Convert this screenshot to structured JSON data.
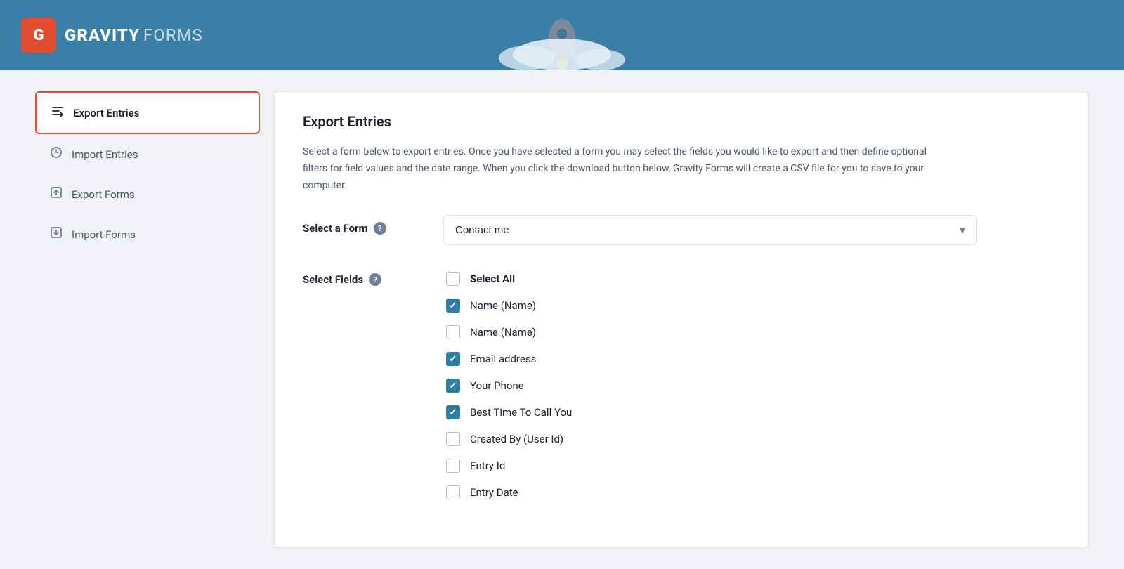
{
  "header": {
    "logo_text_gravity": "GRAVITY",
    "logo_text_forms": "FORMS",
    "logo_letter": "G"
  },
  "sidebar": {
    "items": [
      {
        "id": "export-entries",
        "label": "Export Entries",
        "icon": "export-entries-icon",
        "active": true
      },
      {
        "id": "import-entries",
        "label": "Import Entries",
        "icon": "import-entries-icon",
        "active": false
      },
      {
        "id": "export-forms",
        "label": "Export Forms",
        "icon": "export-forms-icon",
        "active": false
      },
      {
        "id": "import-forms",
        "label": "Import Forms",
        "icon": "import-forms-icon",
        "active": false
      }
    ]
  },
  "content": {
    "title": "Export Entries",
    "description": "Select a form below to export entries. Once you have selected a form you may select the fields you would like to export and then define optional filters for field values and the date range. When you click the download button below, Gravity Forms will create a CSV file for you to save to your computer.",
    "select_form_label": "Select a Form",
    "select_form_placeholder": "Contact me",
    "select_fields_label": "Select Fields",
    "help_tooltip": "?",
    "fields": [
      {
        "id": "select-all",
        "label": "Select All",
        "checked": false,
        "bold": true
      },
      {
        "id": "name-1",
        "label": "Name (Name)",
        "checked": true,
        "bold": false
      },
      {
        "id": "name-2",
        "label": "Name (Name)",
        "checked": false,
        "bold": false
      },
      {
        "id": "email",
        "label": "Email address",
        "checked": true,
        "bold": false
      },
      {
        "id": "phone",
        "label": "Your Phone",
        "checked": true,
        "bold": false
      },
      {
        "id": "best-time",
        "label": "Best Time To Call You",
        "checked": true,
        "bold": false
      },
      {
        "id": "created-by",
        "label": "Created By (User Id)",
        "checked": false,
        "bold": false
      },
      {
        "id": "entry-id",
        "label": "Entry Id",
        "checked": false,
        "bold": false
      },
      {
        "id": "entry-date",
        "label": "Entry Date",
        "checked": false,
        "bold": false
      }
    ]
  }
}
